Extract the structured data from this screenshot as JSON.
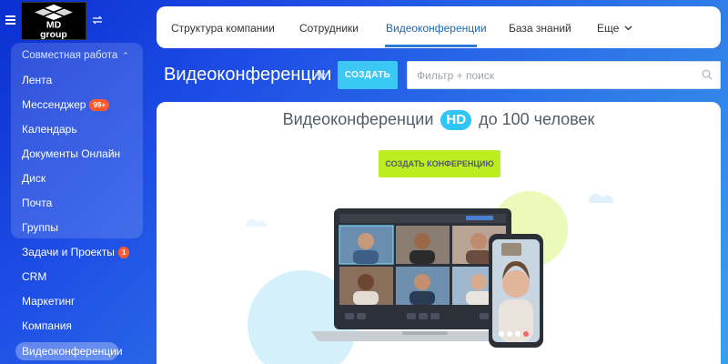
{
  "logo": {
    "line1": "MD",
    "line2": "group"
  },
  "sidebar": {
    "group_title": "Совместная работа",
    "items": [
      {
        "label": "Лента"
      },
      {
        "label": "Мессенджер",
        "badge": "99+"
      },
      {
        "label": "Календарь"
      },
      {
        "label": "Документы Онлайн"
      },
      {
        "label": "Диск"
      },
      {
        "label": "Почта"
      },
      {
        "label": "Группы"
      },
      {
        "label": "Задачи и Проекты",
        "badge": "1"
      },
      {
        "label": "CRM"
      },
      {
        "label": "Маркетинг"
      },
      {
        "label": "Компания"
      },
      {
        "label": "Видеоконференции",
        "active": true
      }
    ]
  },
  "top_nav": {
    "tabs": [
      {
        "label": "Структура компании"
      },
      {
        "label": "Сотрудники"
      },
      {
        "label": "Видеоконференции",
        "active": true
      },
      {
        "label": "База знаний"
      },
      {
        "label": "Еще"
      }
    ]
  },
  "page": {
    "title": "Видеоконференции",
    "create_label": "СОЗДАТЬ",
    "search_placeholder": "Фильтр + поиск"
  },
  "main": {
    "hero_before": "Видеоконференции",
    "hero_badge": "HD",
    "hero_after": "до 100 человек",
    "create_conference_label": "СОЗДАТЬ КОНФЕРЕНЦИЮ"
  },
  "colors": {
    "accent": "#3bc8f5",
    "lime": "#bbed21",
    "badge_red": "#ff5a2c",
    "tab_active": "#2067b0"
  },
  "icons": [
    "menu-icon",
    "swap-icon",
    "chevron-up-icon",
    "star-icon",
    "search-icon",
    "chevron-down-icon"
  ]
}
